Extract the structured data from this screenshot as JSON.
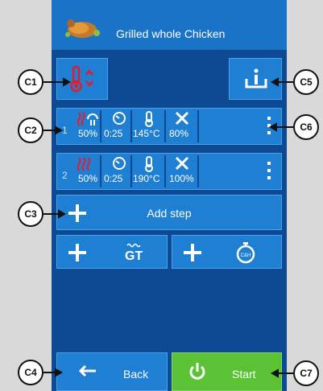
{
  "header": {
    "title": "Grilled whole Chicken"
  },
  "steps": [
    {
      "number": "1",
      "power": "50%",
      "time": "0:25",
      "temp": "145°C",
      "fan": "80%"
    },
    {
      "number": "2",
      "power": "50%",
      "time": "0:25",
      "temp": "190°C",
      "fan": "100%"
    }
  ],
  "add_step": {
    "label": "Add step"
  },
  "gt_label": "GT",
  "back": {
    "label": "Back"
  },
  "start": {
    "label": "Start"
  },
  "callouts": {
    "c1": "C1",
    "c2": "C2",
    "c3": "C3",
    "c4": "C4",
    "c5": "C5",
    "c6": "C6",
    "c7": "C7"
  },
  "colors": {
    "panel": "#0e4a94",
    "button": "#1f7fd2",
    "accent_red": "#e51b2a",
    "start_green": "#5bc236"
  }
}
